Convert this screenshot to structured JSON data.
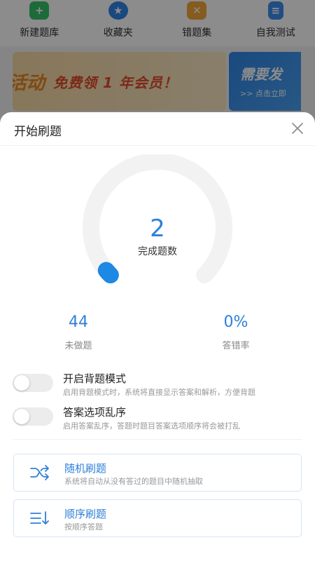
{
  "background": {
    "quick_actions": [
      {
        "label": "新建题库",
        "icon": "plus-icon",
        "glyph": "+",
        "color": "#35c36b"
      },
      {
        "label": "收藏夹",
        "icon": "star-icon",
        "glyph": "★",
        "color": "#2f86e6"
      },
      {
        "label": "错题集",
        "icon": "cross-icon",
        "glyph": "✕",
        "color": "#f5a73a"
      },
      {
        "label": "自我测试",
        "icon": "list-icon",
        "glyph": "≡",
        "color": "#3d8df0"
      }
    ],
    "banner": {
      "left_fragment": "活动",
      "left_text": "免费领 1 年会员！",
      "right_title": "需要发",
      "right_sub": ">> 点击立即"
    }
  },
  "sheet": {
    "title": "开始刷题",
    "gauge": {
      "value": "2",
      "label": "完成题数",
      "fraction": 0.02
    },
    "stats": [
      {
        "value": "44",
        "label": "未做题"
      },
      {
        "value": "0%",
        "label": "答错率"
      }
    ],
    "settings": [
      {
        "title": "开启背题模式",
        "desc": "启用背题模式时，系统将直接显示答案和解析，方便背题",
        "enabled": false
      },
      {
        "title": "答案选项乱序",
        "desc": "启用答案乱序，答题时题目答案选项顺序将会被打乱",
        "enabled": false
      }
    ],
    "modes": [
      {
        "title": "随机刷题",
        "desc": "系统将自动从没有答过的题目中随机抽取",
        "icon": "shuffle-icon"
      },
      {
        "title": "顺序刷题",
        "desc": "按顺序答题",
        "icon": "sort-icon"
      }
    ]
  },
  "colors": {
    "accent": "#2f80d8",
    "gauge_track": "#f2f2f2",
    "gauge_fill": "#1e88e5"
  }
}
